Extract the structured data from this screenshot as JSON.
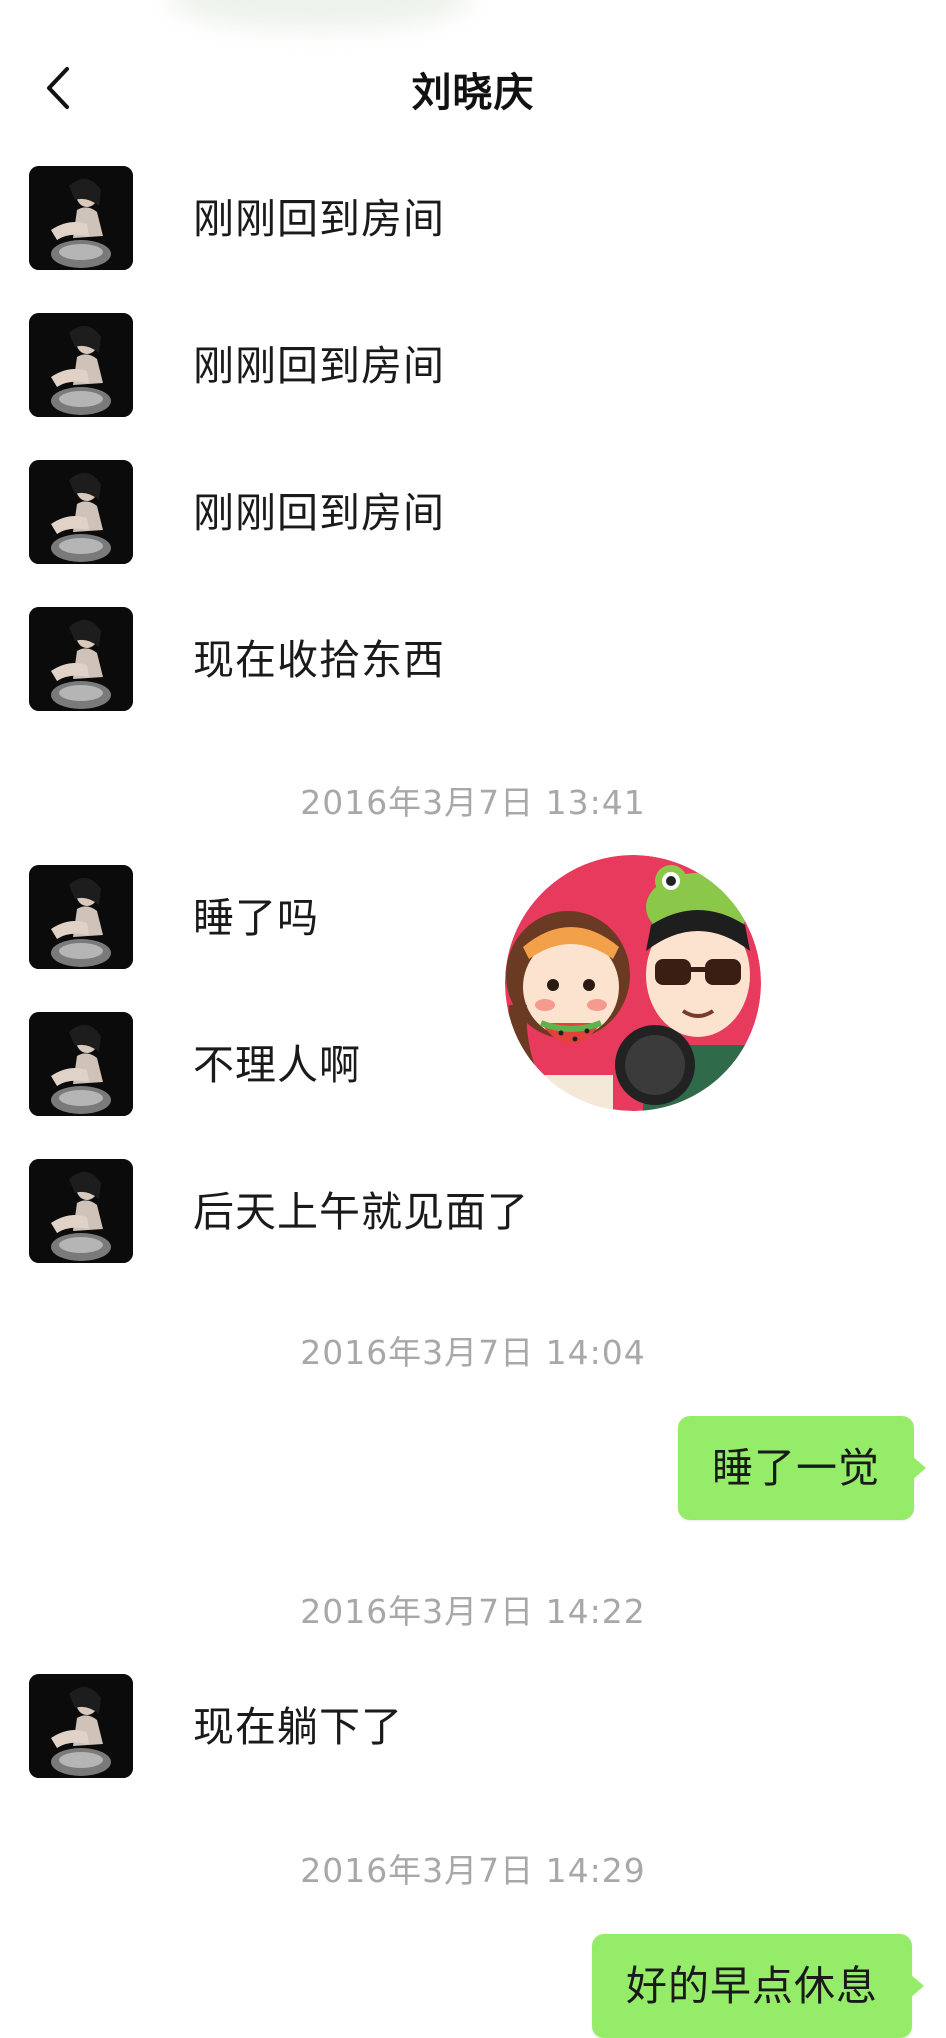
{
  "header": {
    "title": "刘晓庆",
    "back_icon": "chevron-left-icon"
  },
  "messages_incoming_a": [
    {
      "text": "刚刚回到房间"
    },
    {
      "text": "刚刚回到房间"
    },
    {
      "text": "刚刚回到房间"
    },
    {
      "text": "现在收拾东西"
    }
  ],
  "timestamp_1": "2016年3月7日 13:41",
  "messages_incoming_b": [
    {
      "text": "睡了吗"
    },
    {
      "text": "不理人啊"
    },
    {
      "text": "后天上午就见面了"
    }
  ],
  "timestamp_2": "2016年3月7日 14:04",
  "outgoing_1": "睡了一觉",
  "timestamp_3": "2016年3月7日 14:22",
  "incoming_c": "现在躺下了",
  "timestamp_4": "2016年3月7日 14:29",
  "outgoing_2": "好的早点休息",
  "colors": {
    "outgoing_bubble": "#95ec69",
    "timestamp_text": "#a8a8a8",
    "background": "#ffffff",
    "watermark_circle": "#e83a5c"
  }
}
